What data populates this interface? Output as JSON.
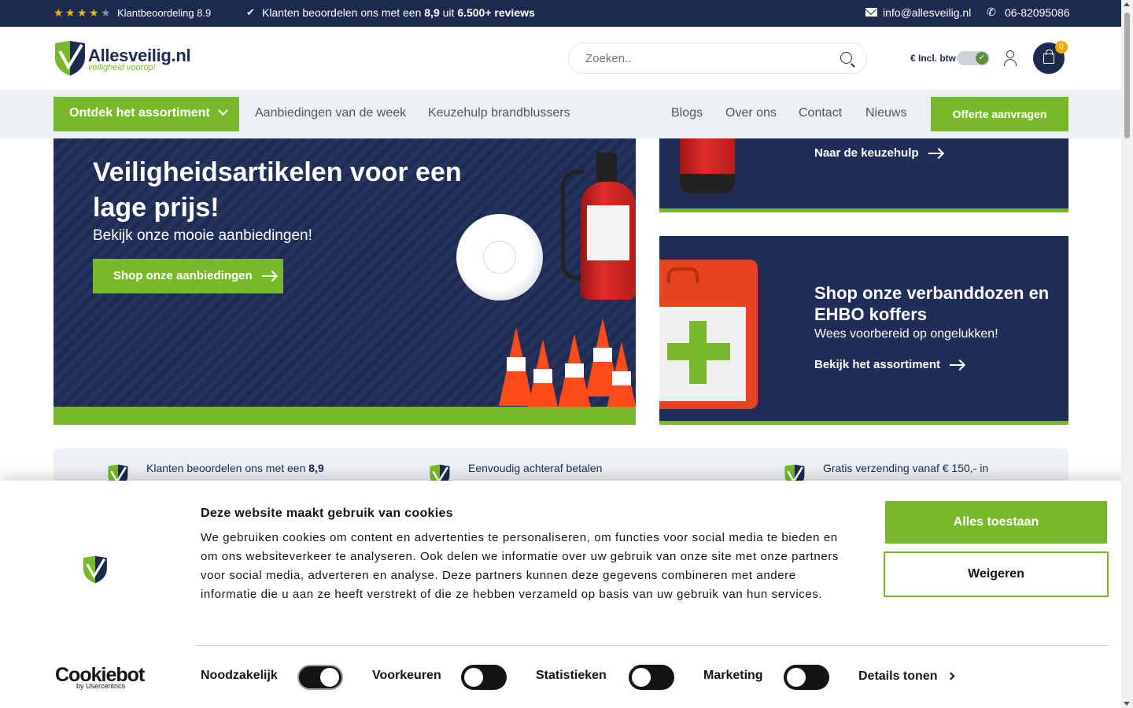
{
  "topbar": {
    "rating_label": "Klantbeoordeling 8.9",
    "stars_filled": 4,
    "stars_total": 5,
    "reviews_prefix": "Klanten beoordelen ons met een ",
    "reviews_score": "8,9",
    "reviews_mid": " uit ",
    "reviews_count": "6.500+ reviews",
    "email": "info@allesveilig.nl",
    "phone": "06-82095086"
  },
  "header": {
    "logo_text": "Allesveilig.nl",
    "logo_tagline": "veiligheid voorop!",
    "search_placeholder": "Zoeken..",
    "btw_label": "€ Incl. btw",
    "cart_count": "0"
  },
  "nav": {
    "assortment_button": "Ontdek het assortiment",
    "links_left": [
      "Aanbiedingen van de week",
      "Keuzehulp brandblussers"
    ],
    "links_right": [
      "Blogs",
      "Over ons",
      "Contact",
      "Nieuws"
    ],
    "quote_button": "Offerte aanvragen"
  },
  "hero": {
    "title": "Veiligheidsartikelen voor een lage prijs!",
    "subtitle": "Bekijk onze mooie aanbiedingen!",
    "button": "Shop onze aanbiedingen"
  },
  "promo_top": {
    "link": "Naar de keuzehulp"
  },
  "promo_bottom": {
    "title": "Shop onze verbanddozen en EHBO koffers",
    "subtitle": "Wees voorbereid op ongelukken!",
    "link": "Bekijk het assortiment"
  },
  "usp": {
    "item1_prefix": "Klanten beoordelen ons met een ",
    "item1_score": "8,9",
    "item2": "Eenvoudig achteraf betalen",
    "item3_bold": "Gratis verzending",
    "item3_rest": " vanaf € 150,- in"
  },
  "cookie": {
    "title": "Deze website maakt gebruik van cookies",
    "text": "We gebruiken cookies om content en advertenties te personaliseren, om functies voor social media te bieden en om ons websiteverkeer te analyseren. Ook delen we informatie over uw gebruik van onze site met onze partners voor social media, adverteren en analyse. Deze partners kunnen deze gegevens combineren met andere informatie die u aan ze heeft verstrekt of die ze hebben verzameld op basis van uw gebruik van hun services.",
    "allow_button": "Alles toestaan",
    "deny_button": "Weigeren",
    "brand": "Cookiebot",
    "brand_sub": "by Usercentrics",
    "categories": [
      {
        "label": "Noodzakelijk",
        "checked": true
      },
      {
        "label": "Voorkeuren",
        "checked": false
      },
      {
        "label": "Statistieken",
        "checked": false
      },
      {
        "label": "Marketing",
        "checked": false
      }
    ],
    "details_link": "Details tonen"
  },
  "colors": {
    "navy": "#1b2a4e",
    "green": "#78b92a",
    "star": "#f7b500"
  }
}
